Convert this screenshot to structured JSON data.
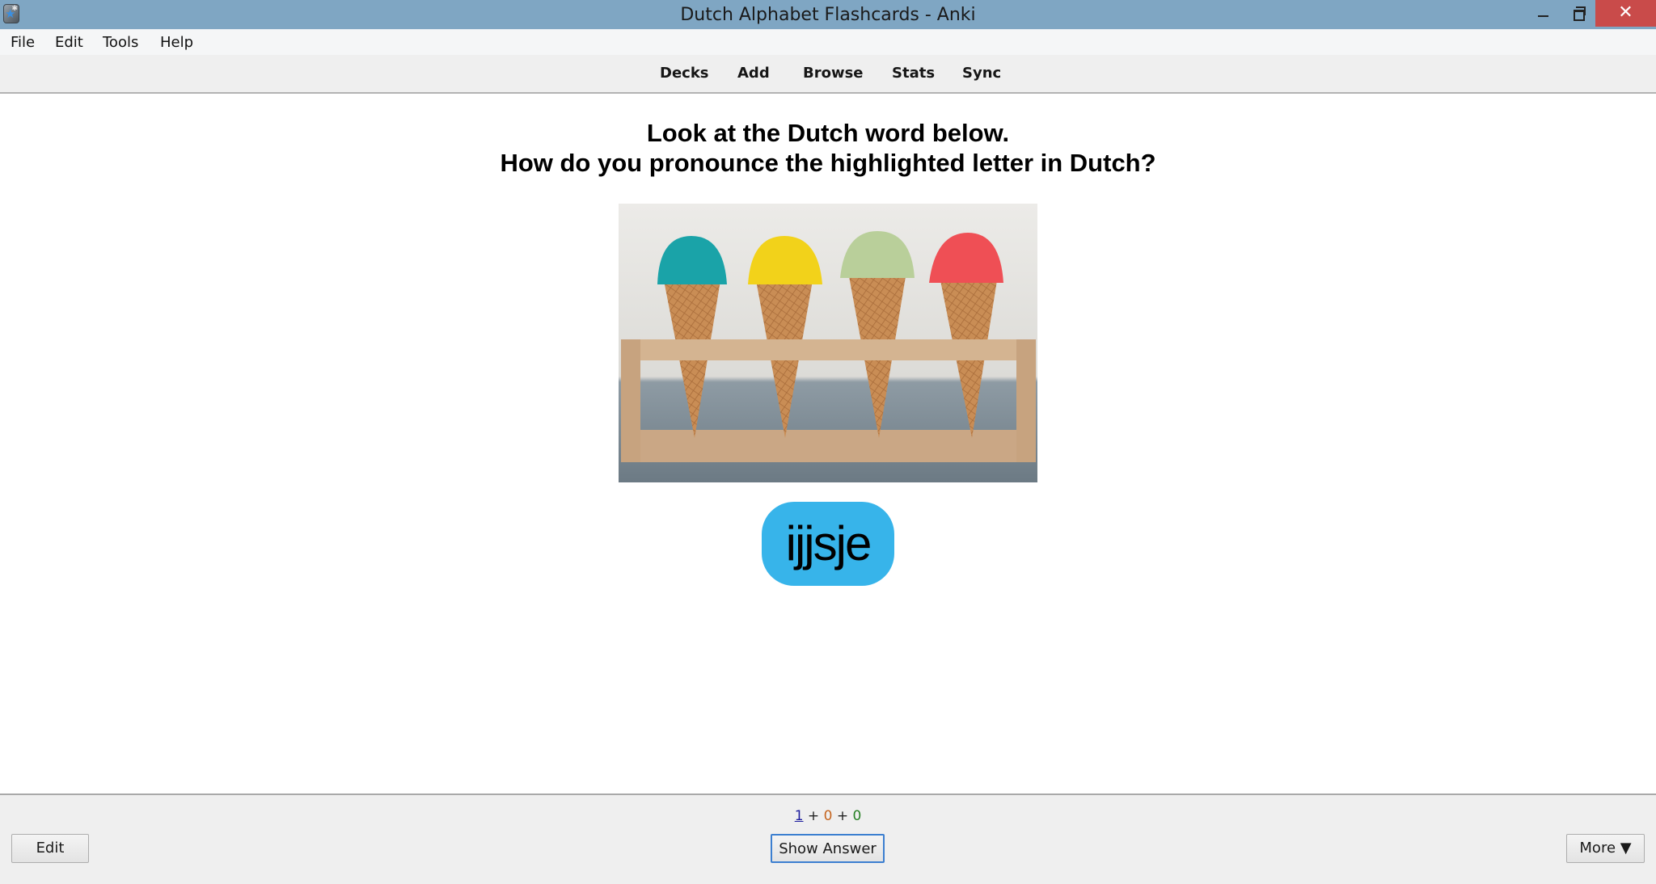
{
  "window": {
    "title": "Dutch Alphabet Flashcards - Anki",
    "minimize_icon": "minimize-icon",
    "maximize_icon": "restore-icon",
    "close_icon": "close-icon",
    "close_glyph": "✕"
  },
  "menubar": {
    "items": [
      {
        "label": "File"
      },
      {
        "label": "Edit"
      },
      {
        "label": "Tools"
      },
      {
        "label": "Help"
      }
    ]
  },
  "toolbar": {
    "links": [
      {
        "label": "Decks"
      },
      {
        "label": "Add"
      },
      {
        "label": "Browse"
      },
      {
        "label": "Stats"
      },
      {
        "label": "Sync"
      }
    ]
  },
  "card": {
    "question_line1": "Look at the Dutch word below.",
    "question_line2": "How do you pronounce the highlighted letter in Dutch?",
    "image_alt": "Four ice cream cones (teal, yellow, pistachio green, red) in a wooden stand",
    "image_scoop_colors": [
      "#1aa3a8",
      "#f2d21a",
      "#b9cf9a",
      "#ef4f55"
    ],
    "word": "ijjsje",
    "word_badge_color": "#37b4ea"
  },
  "bottombar": {
    "counts": {
      "new": "1",
      "learning": "0",
      "review": "0",
      "separator": "+"
    },
    "count_colors": {
      "new": "#1d1d9e",
      "learning": "#c5651f",
      "review": "#268024"
    },
    "edit_label": "Edit",
    "show_answer_label": "Show Answer",
    "more_label": "More ▼"
  }
}
